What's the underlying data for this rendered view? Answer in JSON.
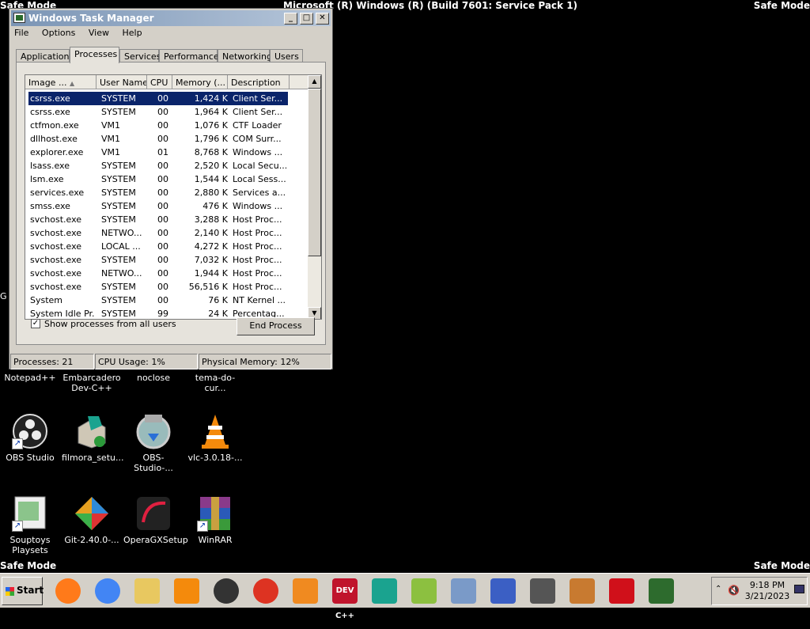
{
  "desktop": {
    "safe_mode": "Safe Mode",
    "build": "Microsoft (R) Windows (R) (Build 7601: Service Pack 1)",
    "left_sliver": "G",
    "row1_labels": [
      "Notepad++",
      "Embarcadero Dev-C++",
      "noclose",
      "tema-do-cur..."
    ],
    "icons": [
      {
        "label": "OBS Studio",
        "icon": "obs-icon"
      },
      {
        "label": "filmora_setu...",
        "icon": "installer-icon"
      },
      {
        "label": "OBS-Studio-...",
        "icon": "nsis-installer-icon"
      },
      {
        "label": "vlc-3.0.18-...",
        "icon": "vlc-cone-icon"
      },
      {
        "label": "Souptoys Playsets",
        "icon": "souptoys-icon"
      },
      {
        "label": "Git-2.40.0-...",
        "icon": "git-icon"
      },
      {
        "label": "OperaGXSetup",
        "icon": "opera-gx-icon"
      },
      {
        "label": "WinRAR",
        "icon": "winrar-icon"
      }
    ]
  },
  "window": {
    "title": "Windows Task Manager",
    "menu": [
      "File",
      "Options",
      "View",
      "Help"
    ],
    "tabs": [
      "Applications",
      "Processes",
      "Services",
      "Performance",
      "Networking",
      "Users"
    ],
    "active_tab": "Processes",
    "columns": [
      "Image ...",
      "User Name",
      "CPU",
      "Memory (...",
      "Description"
    ],
    "rows": [
      {
        "name": "csrss.exe",
        "user": "SYSTEM",
        "cpu": "00",
        "mem": "1,424 K",
        "desc": "Client Ser...",
        "selected": true
      },
      {
        "name": "csrss.exe",
        "user": "SYSTEM",
        "cpu": "00",
        "mem": "1,964 K",
        "desc": "Client Ser..."
      },
      {
        "name": "ctfmon.exe",
        "user": "VM1",
        "cpu": "00",
        "mem": "1,076 K",
        "desc": "CTF Loader"
      },
      {
        "name": "dllhost.exe",
        "user": "VM1",
        "cpu": "00",
        "mem": "1,796 K",
        "desc": "COM Surr..."
      },
      {
        "name": "explorer.exe",
        "user": "VM1",
        "cpu": "01",
        "mem": "8,768 K",
        "desc": "Windows ..."
      },
      {
        "name": "lsass.exe",
        "user": "SYSTEM",
        "cpu": "00",
        "mem": "2,520 K",
        "desc": "Local Secu..."
      },
      {
        "name": "lsm.exe",
        "user": "SYSTEM",
        "cpu": "00",
        "mem": "1,544 K",
        "desc": "Local Sess..."
      },
      {
        "name": "services.exe",
        "user": "SYSTEM",
        "cpu": "00",
        "mem": "2,880 K",
        "desc": "Services a..."
      },
      {
        "name": "smss.exe",
        "user": "SYSTEM",
        "cpu": "00",
        "mem": "476 K",
        "desc": "Windows ..."
      },
      {
        "name": "svchost.exe",
        "user": "SYSTEM",
        "cpu": "00",
        "mem": "3,288 K",
        "desc": "Host Proc..."
      },
      {
        "name": "svchost.exe",
        "user": "NETWO...",
        "cpu": "00",
        "mem": "2,140 K",
        "desc": "Host Proc..."
      },
      {
        "name": "svchost.exe",
        "user": "LOCAL ...",
        "cpu": "00",
        "mem": "4,272 K",
        "desc": "Host Proc..."
      },
      {
        "name": "svchost.exe",
        "user": "SYSTEM",
        "cpu": "00",
        "mem": "7,032 K",
        "desc": "Host Proc..."
      },
      {
        "name": "svchost.exe",
        "user": "NETWO...",
        "cpu": "00",
        "mem": "1,944 K",
        "desc": "Host Proc..."
      },
      {
        "name": "svchost.exe",
        "user": "SYSTEM",
        "cpu": "00",
        "mem": "56,516 K",
        "desc": "Host Proc..."
      },
      {
        "name": "System",
        "user": "SYSTEM",
        "cpu": "00",
        "mem": "76 K",
        "desc": "NT Kernel ..."
      },
      {
        "name": "System Idle Pr...",
        "user": "SYSTEM",
        "cpu": "99",
        "mem": "24 K",
        "desc": "Percentag..."
      }
    ],
    "show_all_label": "Show processes from all users",
    "show_all_checked": true,
    "end_process_label": "End Process",
    "status": {
      "processes": "Processes: 21",
      "cpu": "CPU Usage: 1%",
      "memory": "Physical Memory: 12%"
    }
  },
  "taskbar": {
    "start_label": "Start",
    "pinned": [
      {
        "name": "firefox-icon"
      },
      {
        "name": "chrome-icon"
      },
      {
        "name": "file-explorer-icon"
      },
      {
        "name": "vlc-icon"
      },
      {
        "name": "obs-icon"
      },
      {
        "name": "mega-icon"
      },
      {
        "name": "search-magnifier-icon"
      },
      {
        "name": "dev-cpp-icon",
        "text": "DEV C++"
      },
      {
        "name": "filmora-icon"
      },
      {
        "name": "notepad-plus-plus-icon"
      },
      {
        "name": "text-editor-icon"
      },
      {
        "name": "infinity-icon"
      },
      {
        "name": "tools-icon"
      },
      {
        "name": "souptoys-icon"
      },
      {
        "name": "s-logo-icon"
      },
      {
        "name": "task-manager-icon"
      }
    ],
    "clock_time": "9:18 PM",
    "clock_date": "3/21/2023"
  },
  "colors": {
    "desktop": "#000000",
    "selection": "#0a246a",
    "title_bar": "#7b95b5"
  }
}
